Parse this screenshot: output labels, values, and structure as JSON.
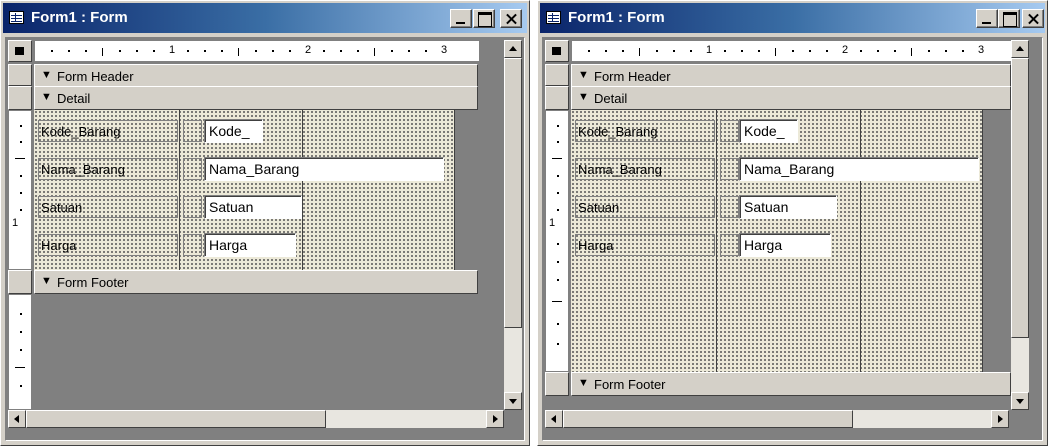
{
  "windows": [
    {
      "title": "Form1 : Form",
      "ruler": [
        "1",
        "2",
        "3"
      ],
      "vruler": [
        "1"
      ],
      "sections": {
        "header": "Form Header",
        "detail": "Detail",
        "footer": "Form Footer"
      },
      "fields": [
        {
          "label": "Kode_Barang",
          "value": "Kode_"
        },
        {
          "label": "Nama_Barang",
          "value": "Nama_Barang"
        },
        {
          "label": "Satuan",
          "value": "Satuan"
        },
        {
          "label": "Harga",
          "value": "Harga"
        }
      ]
    },
    {
      "title": "Form1 : Form",
      "ruler": [
        "1",
        "2",
        "3"
      ],
      "vruler": [
        "1"
      ],
      "sections": {
        "header": "Form Header",
        "detail": "Detail",
        "footer": "Form Footer"
      },
      "fields": [
        {
          "label": "Kode_Barang",
          "value": "Kode_"
        },
        {
          "label": "Nama_Barang",
          "value": "Nama_Barang"
        },
        {
          "label": "Satuan",
          "value": "Satuan"
        },
        {
          "label": "Harga",
          "value": "Harga"
        }
      ]
    }
  ],
  "icons": {
    "app": "form-design-icon",
    "minimize": "minimize-icon",
    "maximize": "maximize-icon",
    "close": "close-icon",
    "section_marker": "section-arrow-icon",
    "scroll_up": "arrow-up-icon",
    "scroll_down": "arrow-down-icon",
    "scroll_left": "arrow-left-icon",
    "scroll_right": "arrow-right-icon"
  },
  "colors": {
    "titlebar": "#0a246a",
    "chrome": "#d4d0c8",
    "grid": "#ece9d8",
    "workspace": "#808080"
  }
}
